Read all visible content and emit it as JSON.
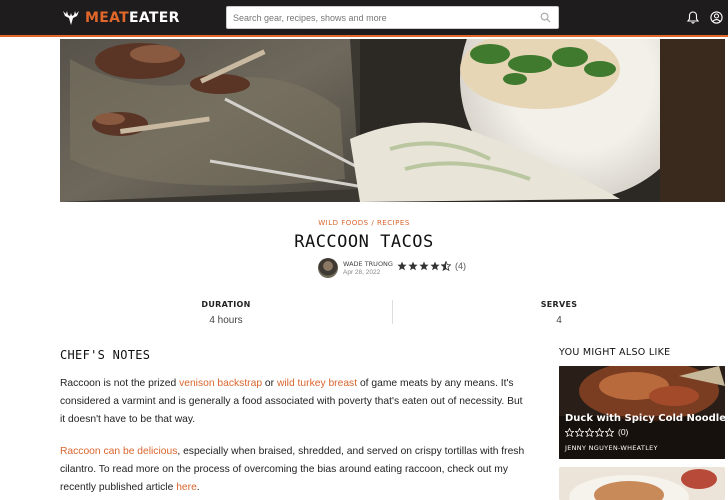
{
  "header": {
    "logo_part1": "MEAT",
    "logo_part2": "EATER",
    "search_placeholder": "Search gear, recipes, shows and more",
    "icons": [
      "logo-icon",
      "search-icon",
      "bell-icon",
      "user-icon"
    ],
    "accent_color": "#e2672a",
    "bg_color": "#1e1c1d"
  },
  "breadcrumb": {
    "category": "WILD FOODS",
    "separator": "/",
    "section": "RECIPES"
  },
  "recipe": {
    "title": "RACCOON TACOS",
    "author": "WADE TRUONG",
    "date": "Apr 28, 2022",
    "rating": 4.5,
    "rating_count": "(4)",
    "duration_label": "DURATION",
    "duration_value": "4 hours",
    "serves_label": "SERVES",
    "serves_value": "4"
  },
  "notes": {
    "heading": "CHEF'S NOTES",
    "p1_a": "Raccoon is not the prized ",
    "p1_link1": "venison backstrap",
    "p1_b": " or ",
    "p1_link2": "wild turkey breast",
    "p1_c": " of game meats by any means. It's considered a varmint and is generally a food associated with poverty that's eaten out of necessity. But it doesn't have to be that way.",
    "p2_link1": "Raccoon can be delicious",
    "p2_a": ", especially when braised, shredded, and served on crispy tortillas with fresh cilantro. To read more on the process of overcoming the bias around eating raccoon, check out my recently published article ",
    "p2_link2": "here",
    "p2_b": "."
  },
  "sidebar": {
    "heading": "YOU MIGHT ALSO LIKE",
    "card1": {
      "title": "Duck with Spicy Cold Noodles",
      "rating": 0,
      "rating_count": "(0)",
      "author": "JENNY NGUYEN-WHEATLEY"
    }
  }
}
